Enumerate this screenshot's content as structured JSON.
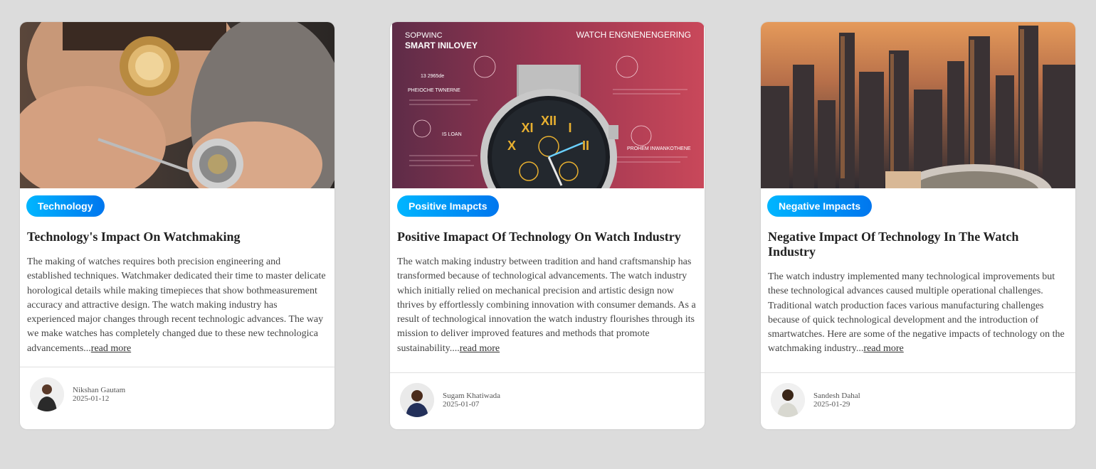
{
  "cards": [
    {
      "tag": "Technology",
      "title": "Technology's Impact On Watchmaking",
      "description": "The making of watches requires both precision engineering and established techniques. Watchmaker dedicated their time to master delicate horological details while making timepieces that show bothmeasurement accuracy and attractive design. The watch making industry has experienced major changes through recent technologic advances. The way we make watches has completely changed due to these new technologica advancements...",
      "read_more": "read more",
      "author": "Nikshan Gautam",
      "date": "2025-01-12"
    },
    {
      "tag": "Positive Imapcts",
      "title": "Positive Imapact Of Technology On Watch Industry",
      "description": "The watch making industry between tradition and hand craftsmanship has transformed because of technological advancements. The watch industry which initially relied on mechanical precision and artistic design now thrives by effortlessly combining innovation with consumer demands. As a result of technological innovation the watch industry flourishes through its mission to deliver improved features and methods that promote sustainability....",
      "read_more": "read more",
      "author": "Sugam Khatiwada",
      "date": "2025-01-07",
      "image_text": {
        "left_heading_1": "SOPWINC",
        "left_heading_2": "SMART INILOVEY",
        "right_heading": "WATCH ENGNENENGERING",
        "left_label_1": "PHEIOCHE TWNERNE",
        "left_label_2": "13 2965de",
        "left_label_3": "IS LOAN",
        "right_label": "PROHEM INWANKOTHENE"
      }
    },
    {
      "tag": "Negative Impacts",
      "title": "Negative Impact Of Technology In The Watch Industry",
      "description": "The watch industry implemented many technological improvements but these technological advances caused multiple operational challenges. Traditional watch production faces various manufacturing challenges because of quick technological development and the introduction of smartwatches. Here are some of the negative impacts of technology on the watchmaking industry...",
      "read_more": "read more",
      "author": "Sandesh Dahal",
      "date": "2025-01-29"
    }
  ],
  "colors": {
    "badge_start": "#00b6ff",
    "badge_end": "#0076ee",
    "background": "#dcdcdc",
    "card": "#ffffff"
  }
}
